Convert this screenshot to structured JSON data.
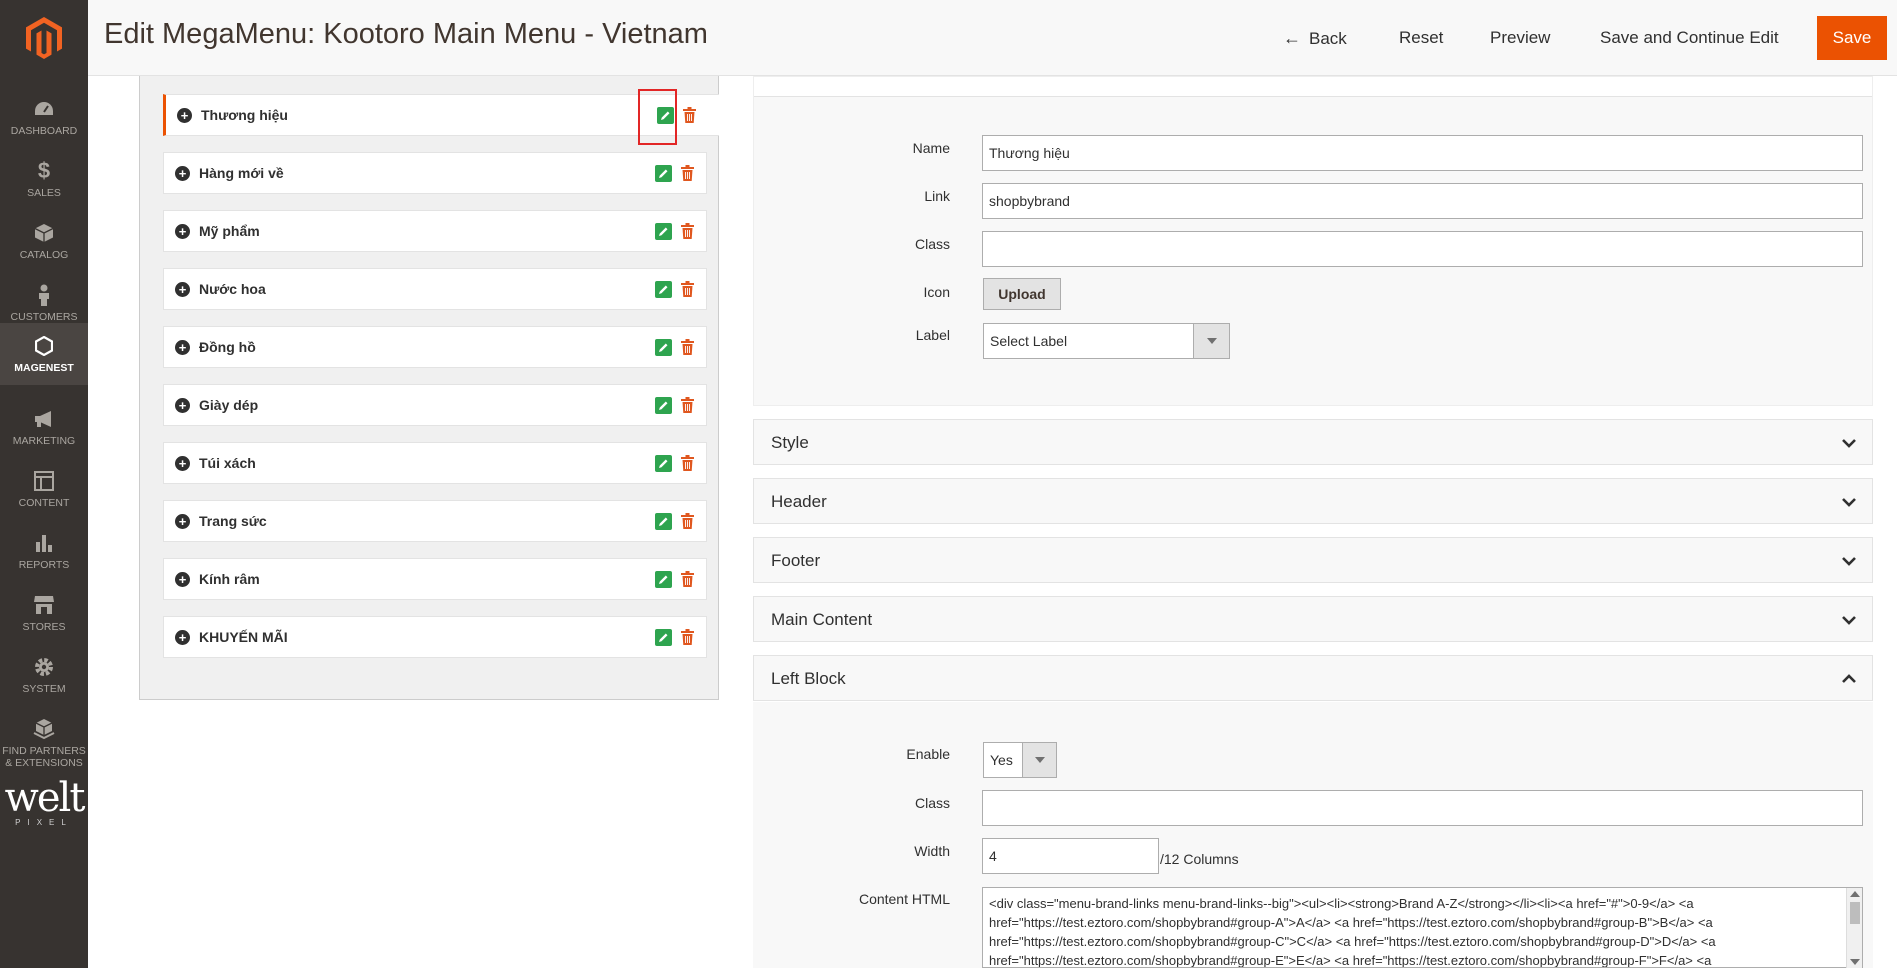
{
  "header": {
    "title": "Edit MegaMenu: Kootoro Main Menu - Vietnam",
    "back_label": "Back",
    "reset_label": "Reset",
    "preview_label": "Preview",
    "save_continue_label": "Save and Continue Edit",
    "save_label": "Save"
  },
  "sidebar": {
    "items": [
      {
        "label": "DASHBOARD",
        "icon": "dashboard-icon"
      },
      {
        "label": "SALES",
        "icon": "dollar-icon"
      },
      {
        "label": "CATALOG",
        "icon": "box-icon"
      },
      {
        "label": "CUSTOMERS",
        "icon": "person-icon"
      },
      {
        "label": "MAGENEST",
        "icon": "hexagon-icon"
      },
      {
        "label": "MARKETING",
        "icon": "megaphone-icon"
      },
      {
        "label": "CONTENT",
        "icon": "layout-icon"
      },
      {
        "label": "REPORTS",
        "icon": "bar-chart-icon"
      },
      {
        "label": "STORES",
        "icon": "store-icon"
      },
      {
        "label": "SYSTEM",
        "icon": "gear-icon"
      },
      {
        "label": "FIND PARTNERS & EXTENSIONS",
        "icon": "cubes-icon"
      }
    ],
    "brand_main": "welt",
    "brand_sub": "PIXEL"
  },
  "menu_tree": {
    "items": [
      "Thương hiệu",
      "Hàng mới về",
      "Mỹ phẩm",
      "Nước hoa",
      "Đồng hồ",
      "Giày dép",
      "Túi xách",
      "Trang sức",
      "Kính râm",
      "KHUYẾN MÃI"
    ]
  },
  "info": {
    "name_label": "Name",
    "name_value": "Thương hiệu",
    "link_label": "Link",
    "link_value": "shopbybrand",
    "class_label": "Class",
    "class_value": "",
    "icon_label": "Icon",
    "upload_label": "Upload",
    "label_label": "Label",
    "label_selected": "Select Label"
  },
  "sections": {
    "style": "Style",
    "header": "Header",
    "footer": "Footer",
    "main_content": "Main Content",
    "left_block": "Left Block"
  },
  "left_block": {
    "enable_label": "Enable",
    "enable_value": "Yes",
    "class_label": "Class",
    "class_value": "",
    "width_label": "Width",
    "width_value": "4",
    "width_suffix": "/12 Columns",
    "content_label": "Content HTML",
    "content_value": "<div class=\"menu-brand-links menu-brand-links--big\"><ul><li><strong>Brand A-Z</strong></li><li><a href=\"#\">0-9</a> <a href=\"https://test.eztoro.com/shopbybrand#group-A\">A</a> <a href=\"https://test.eztoro.com/shopbybrand#group-B\">B</a> <a href=\"https://test.eztoro.com/shopbybrand#group-C\">C</a> <a href=\"https://test.eztoro.com/shopbybrand#group-D\">D</a> <a href=\"https://test.eztoro.com/shopbybrand#group-E\">E</a> <a href=\"https://test.eztoro.com/shopbybrand#group-F\">F</a> <a"
  },
  "colors": {
    "accent": "#eb5202",
    "sidebar_bg": "#373330",
    "edit_green": "#2ea44f",
    "delete_orange": "#e0571f",
    "highlight_red": "#e22626"
  }
}
